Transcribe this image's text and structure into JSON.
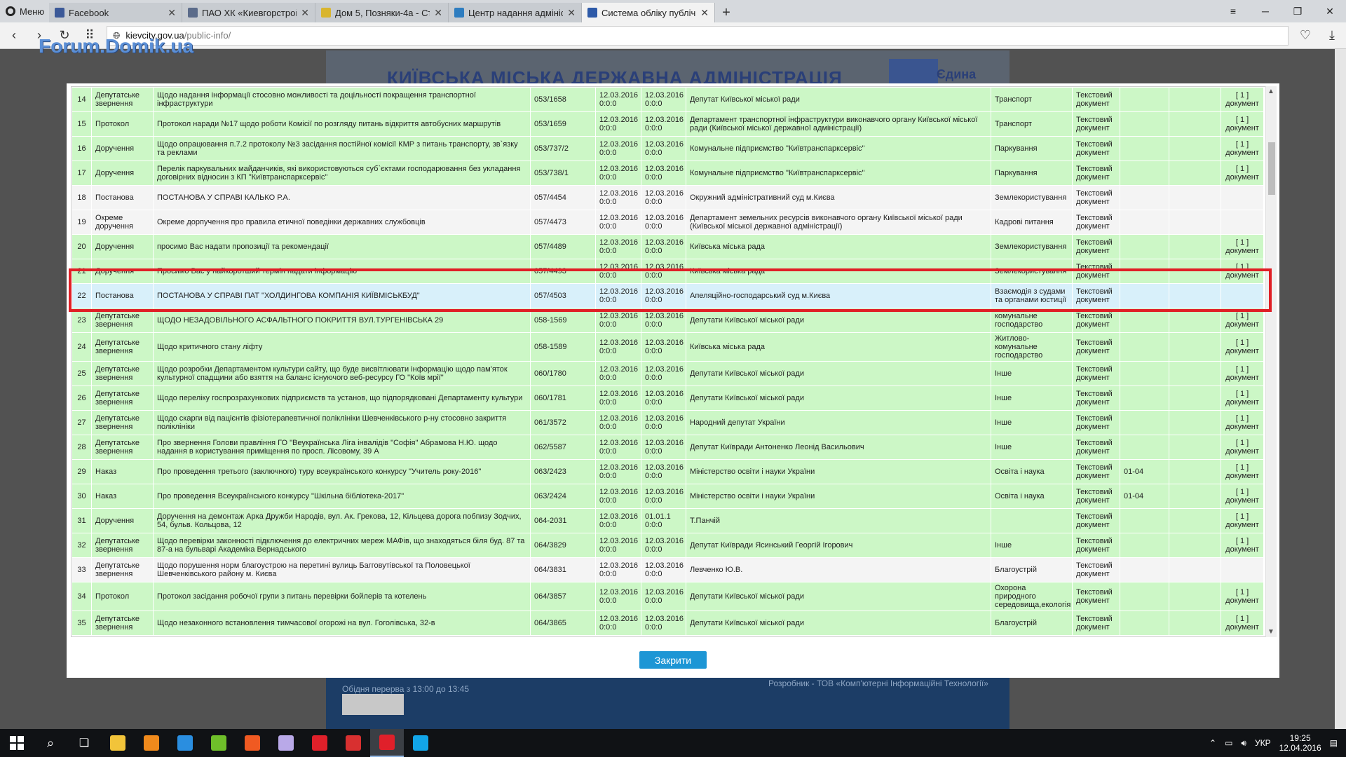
{
  "browser": {
    "menu_label": "Меню",
    "tabs": [
      {
        "label": "Facebook",
        "color": "#3b5998"
      },
      {
        "label": "ПАО ХК «Киевгорстрой»",
        "color": "#5b6b8a"
      },
      {
        "label": "Дом 5, Позняки-4а - Стр",
        "color": "#d9b52e"
      },
      {
        "label": "Центр надання адмініст",
        "color": "#2e7dc0"
      },
      {
        "label": "Система обліку публічно",
        "color": "#2e5aa8"
      }
    ],
    "url_host": "kievcity.gov.ua",
    "url_path": "/public-info/"
  },
  "page": {
    "forum_logo": "Forum.Domik.ua",
    "kmda_title": "КИЇВСЬКА МІСЬКА ДЕРЖАВНА АДМІНІСТРАЦІЯ",
    "edyna": "Єдина",
    "footer_text": "Обідня перерва з 13:00 до 13:45",
    "footer_dev": "Розробник - ТОВ «Комп'ютерні Інформаційні Технології»"
  },
  "modal": {
    "close_label": "Закрити",
    "rows": [
      {
        "n": "14",
        "type": "Депутатське звернення",
        "title": "Щодо надання інформації стосовно можливості та доцільності покращення транспортної інфраструктури",
        "reg": "053/1658",
        "d1": "12.03.2016 0:0:0",
        "d2": "12.03.2016 0:0:0",
        "org": "Депутат Київської міської ради",
        "topic": "Транспорт",
        "kind": "Текстовий документ",
        "code": "",
        "extra": "",
        "att": "[ 1 ] документ",
        "style": "g"
      },
      {
        "n": "15",
        "type": "Протокол",
        "title": "Протокол наради №17 щодо роботи Комісії по розгляду питань відкриття автобусних маршрутів",
        "reg": "053/1659",
        "d1": "12.03.2016 0:0:0",
        "d2": "12.03.2016 0:0:0",
        "org": "Департамент транспортної інфраструктури виконавчого органу Київської міської ради (Київської міської державної адміністрації)",
        "topic": "Транспорт",
        "kind": "Текстовий документ",
        "code": "",
        "extra": "",
        "att": "[ 1 ] документ",
        "style": "g"
      },
      {
        "n": "16",
        "type": "Доручення",
        "title": "Щодо опрацювання п.7.2 протоколу №3 засідання постійної комісії КМР з питань транспорту, зв`язку та реклами",
        "reg": "053/737/2",
        "d1": "12.03.2016 0:0:0",
        "d2": "12.03.2016 0:0:0",
        "org": "Комунальне підприємство \"Київтранспарксервіс\"",
        "topic": "Паркування",
        "kind": "Текстовий документ",
        "code": "",
        "extra": "",
        "att": "[ 1 ] документ",
        "style": "g"
      },
      {
        "n": "17",
        "type": "Доручення",
        "title": "Перелік паркувальних майданчиків, які використовуються суб`єктами господарювання без укладання договірних відносин з КП \"Київтранспарксервіс\"",
        "reg": "053/738/1",
        "d1": "12.03.2016 0:0:0",
        "d2": "12.03.2016 0:0:0",
        "org": "Комунальне підприємство \"Київтранспарксервіс\"",
        "topic": "Паркування",
        "kind": "Текстовий документ",
        "code": "",
        "extra": "",
        "att": "[ 1 ] документ",
        "style": "g"
      },
      {
        "n": "18",
        "type": "Постанова",
        "title": "ПОСТАНОВА У СПРАВІ КАЛЬКО Р.А.",
        "reg": "057/4454",
        "d1": "12.03.2016 0:0:0",
        "d2": "12.03.2016 0:0:0",
        "org": "Окружний адміністративний суд м.Києва",
        "topic": "Землекористування",
        "kind": "Текстовий документ",
        "code": "",
        "extra": "",
        "att": "",
        "style": "w"
      },
      {
        "n": "19",
        "type": "Окреме доручення",
        "title": "Окреме дорпучення про правила етичної поведінки державних службовців",
        "reg": "057/4473",
        "d1": "12.03.2016 0:0:0",
        "d2": "12.03.2016 0:0:0",
        "org": "Департамент земельних ресурсів виконавчого органу Київської міської ради (Київської міської державної адміністрації)",
        "topic": "Кадрові питання",
        "kind": "Текстовий документ",
        "code": "",
        "extra": "",
        "att": "",
        "style": "w"
      },
      {
        "n": "20",
        "type": "Доручення",
        "title": "просимо Вас надати пропозиції та рекомендації",
        "reg": "057/4489",
        "d1": "12.03.2016 0:0:0",
        "d2": "12.03.2016 0:0:0",
        "org": "Київська міська рада",
        "topic": "Землекористування",
        "kind": "Текстовий документ",
        "code": "",
        "extra": "",
        "att": "[ 1 ] документ",
        "style": "g"
      },
      {
        "n": "21",
        "type": "Доручення",
        "title": "Просимо Вас у найкоротший термін надати інформацію",
        "reg": "057/4493",
        "d1": "12.03.2016 0:0:0",
        "d2": "12.03.2016 0:0:0",
        "org": "Київська міська рада",
        "topic": "Землекористування",
        "kind": "Текстовий документ",
        "code": "",
        "extra": "",
        "att": "[ 1 ] документ",
        "style": "g"
      },
      {
        "n": "22",
        "type": "Постанова",
        "title": "ПОСТАНОВА У СПРАВІ ПАТ \"ХОЛДИНГОВА КОМПАНІЯ КИЇВМІСЬКБУД\"",
        "reg": "057/4503",
        "d1": "12.03.2016 0:0:0",
        "d2": "12.03.2016 0:0:0",
        "org": "Апеляційно-господарський суд м.Києва",
        "topic": "Взаємодія з судами та органами юстиції",
        "kind": "Текстовий документ",
        "code": "",
        "extra": "",
        "att": "",
        "style": "b"
      },
      {
        "n": "23",
        "type": "Депутатське звернення",
        "title": "ЩОДО НЕЗАДОВІЛЬНОГО АСФАЛЬТНОГО ПОКРИТТЯ ВУЛ.ТУРГЕНІВСЬКА 29",
        "reg": "058-1569",
        "d1": "12.03.2016 0:0:0",
        "d2": "12.03.2016 0:0:0",
        "org": "Депутати Київської міської ради",
        "topic": "комунальне господарство",
        "kind": "Текстовий документ",
        "code": "",
        "extra": "",
        "att": "[ 1 ] документ",
        "style": "g"
      },
      {
        "n": "24",
        "type": "Депутатське звернення",
        "title": "Щодо критичного стану ліфту",
        "reg": "058-1589",
        "d1": "12.03.2016 0:0:0",
        "d2": "12.03.2016 0:0:0",
        "org": "Київська міська рада",
        "topic": "Житлово-комунальне господарство",
        "kind": "Текстовий документ",
        "code": "",
        "extra": "",
        "att": "[ 1 ] документ",
        "style": "g"
      },
      {
        "n": "25",
        "type": "Депутатське звернення",
        "title": "Щодо розробки Департаментом культури сайту, що буде висвітлювати інформацію щодо пам'яток культурної спадщини або взяття на баланс існуючого веб-ресурсу ГО \"Коїв мрії\"",
        "reg": "060/1780",
        "d1": "12.03.2016 0:0:0",
        "d2": "12.03.2016 0:0:0",
        "org": "Депутати Київської міської ради",
        "topic": "Інше",
        "kind": "Текстовий документ",
        "code": "",
        "extra": "",
        "att": "[ 1 ] документ",
        "style": "g"
      },
      {
        "n": "26",
        "type": "Депутатське звернення",
        "title": "Щодо переліку госпрозрахункових підприємств та установ, що підпорядковані Департаменту культури",
        "reg": "060/1781",
        "d1": "12.03.2016 0:0:0",
        "d2": "12.03.2016 0:0:0",
        "org": "Депутати Київської міської ради",
        "topic": "Інше",
        "kind": "Текстовий документ",
        "code": "",
        "extra": "",
        "att": "[ 1 ] документ",
        "style": "g"
      },
      {
        "n": "27",
        "type": "Депутатське звернення",
        "title": "Щодо скарги від пацієнтів фізіотерапевтичної поліклініки Шевченківського р-ну стосовно закриття поліклініки",
        "reg": "061/3572",
        "d1": "12.03.2016 0:0:0",
        "d2": "12.03.2016 0:0:0",
        "org": "Народний депутат України",
        "topic": "Інше",
        "kind": "Текстовий документ",
        "code": "",
        "extra": "",
        "att": "[ 1 ] документ",
        "style": "g"
      },
      {
        "n": "28",
        "type": "Депутатське звернення",
        "title": "Про звернення Голови правління ГО \"Веукраїнська Ліга інвалідів \"Софія\" Абрамова Н.Ю. щодо надання в користування приміщення по просп. Лісовому, 39 А",
        "reg": "062/5587",
        "d1": "12.03.2016 0:0:0",
        "d2": "12.03.2016 0:0:0",
        "org": "Депутат Київради Антоненко Леонід Васильович",
        "topic": "Інше",
        "kind": "Текстовий документ",
        "code": "",
        "extra": "",
        "att": "[ 1 ] документ",
        "style": "g"
      },
      {
        "n": "29",
        "type": "Наказ",
        "title": "Про проведення третього (заключного) туру всеукраїнського конкурсу \"Учитель року-2016\"",
        "reg": "063/2423",
        "d1": "12.03.2016 0:0:0",
        "d2": "12.03.2016 0:0:0",
        "org": "Міністерство освіти і науки України",
        "topic": "Освіта і наука",
        "kind": "Текстовий документ",
        "code": "01-04",
        "extra": "",
        "att": "[ 1 ] документ",
        "style": "g"
      },
      {
        "n": "30",
        "type": "Наказ",
        "title": "Про проведення Всеукраїнського конкурсу \"Шкільна бібліотека-2017\"",
        "reg": "063/2424",
        "d1": "12.03.2016 0:0:0",
        "d2": "12.03.2016 0:0:0",
        "org": "Міністерство освіти і науки України",
        "topic": "Освіта і наука",
        "kind": "Текстовий документ",
        "code": "01-04",
        "extra": "",
        "att": "[ 1 ] документ",
        "style": "g"
      },
      {
        "n": "31",
        "type": "Доручення",
        "title": "Доручення на демонтаж Арка Дружби Народів, вул. Ак. Грекова, 12, Кільцева дорога побпизу Зодчих, 54, бульв. Кольцова, 12",
        "reg": "064-2031",
        "d1": "12.03.2016 0:0:0",
        "d2": "01.01.1 0:0:0",
        "org": "Т.Панчій",
        "topic": "",
        "kind": "Текстовий документ",
        "code": "",
        "extra": "",
        "att": "[ 1 ] документ",
        "style": "g"
      },
      {
        "n": "32",
        "type": "Депутатське звернення",
        "title": "Щодо перевірки законності підключення до електричних мереж МАФів, що знаходяться біля буд. 87 та 87-а на бульварі Академіка Вернадського",
        "reg": "064/3829",
        "d1": "12.03.2016 0:0:0",
        "d2": "12.03.2016 0:0:0",
        "org": "Депутат Київради Ясинський Георгій Ігорович",
        "topic": "Інше",
        "kind": "Текстовий документ",
        "code": "",
        "extra": "",
        "att": "[ 1 ] документ",
        "style": "g"
      },
      {
        "n": "33",
        "type": "Депутатське звернення",
        "title": "Щодо порушення норм благоустрою на перетині вулиць Бaгговутівської та Половецької Шевченківського району м. Києва",
        "reg": "064/3831",
        "d1": "12.03.2016 0:0:0",
        "d2": "12.03.2016 0:0:0",
        "org": "Левченко Ю.В.",
        "topic": "Благоустрій",
        "kind": "Текстовий документ",
        "code": "",
        "extra": "",
        "att": "",
        "style": "w"
      },
      {
        "n": "34",
        "type": "Протокол",
        "title": "Протокол засідання робочої групи з питань перевірки бойлерів та котелень",
        "reg": "064/3857",
        "d1": "12.03.2016 0:0:0",
        "d2": "12.03.2016 0:0:0",
        "org": "Депутати Київської міської ради",
        "topic": "Охорона природного середовища,екологія",
        "kind": "Текстовий документ",
        "code": "",
        "extra": "",
        "att": "[ 1 ] документ",
        "style": "g"
      },
      {
        "n": "35",
        "type": "Депутатське звернення",
        "title": "Щодо незаконного встановлення тимчасової огорожі на вул. Гоголівська, 32-в",
        "reg": "064/3865",
        "d1": "12.03.2016 0:0:0",
        "d2": "12.03.2016 0:0:0",
        "org": "Депутати Київської міської ради",
        "topic": "Благоустрій",
        "kind": "Текстовий документ",
        "code": "",
        "extra": "",
        "att": "[ 1 ] документ",
        "style": "g"
      }
    ]
  },
  "taskbar": {
    "icons": [
      {
        "name": "file-explorer-icon",
        "color": "#f2c43a"
      },
      {
        "name": "avast-icon",
        "color": "#f08a1c"
      },
      {
        "name": "calculator-icon",
        "color": "#2a8ee0"
      },
      {
        "name": "utorrent-icon",
        "color": "#6fbf2a"
      },
      {
        "name": "origin-icon",
        "color": "#f05a22"
      },
      {
        "name": "visual-studio-icon",
        "color": "#b9a9e8"
      },
      {
        "name": "opera-icon",
        "color": "#e0202a"
      },
      {
        "name": "media-player-icon",
        "color": "#d83030"
      },
      {
        "name": "opera-active-icon",
        "color": "#e0202a"
      },
      {
        "name": "skype-icon",
        "color": "#12a5e8"
      }
    ],
    "lang": "УКР",
    "time": "19:25",
    "date": "12.04.2016"
  }
}
